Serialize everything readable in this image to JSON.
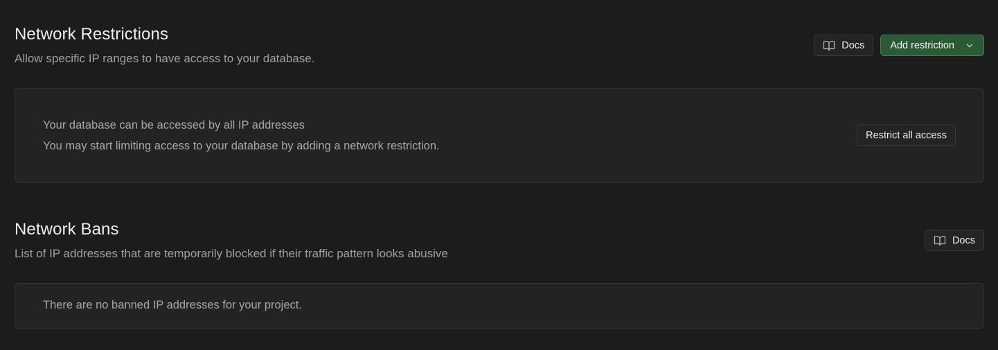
{
  "restrictions": {
    "title": "Network Restrictions",
    "description": "Allow specific IP ranges to have access to your database.",
    "docs_label": "Docs",
    "add_label": "Add restriction",
    "card": {
      "line1": "Your database can be accessed by all IP addresses",
      "line2": "You may start limiting access to your database by adding a network restriction.",
      "restrict_label": "Restrict all access"
    }
  },
  "bans": {
    "title": "Network Bans",
    "description": "List of IP addresses that are temporarily blocked if their traffic pattern looks abusive",
    "docs_label": "Docs",
    "empty_text": "There are no banned IP addresses for your project."
  },
  "icons": {
    "docs": "book-open-icon",
    "dropdown": "chevron-down-icon"
  },
  "colors": {
    "background": "#1c1c1c",
    "card": "#232323",
    "primary_button": "#2c5a36",
    "primary_border": "#3e8050"
  }
}
